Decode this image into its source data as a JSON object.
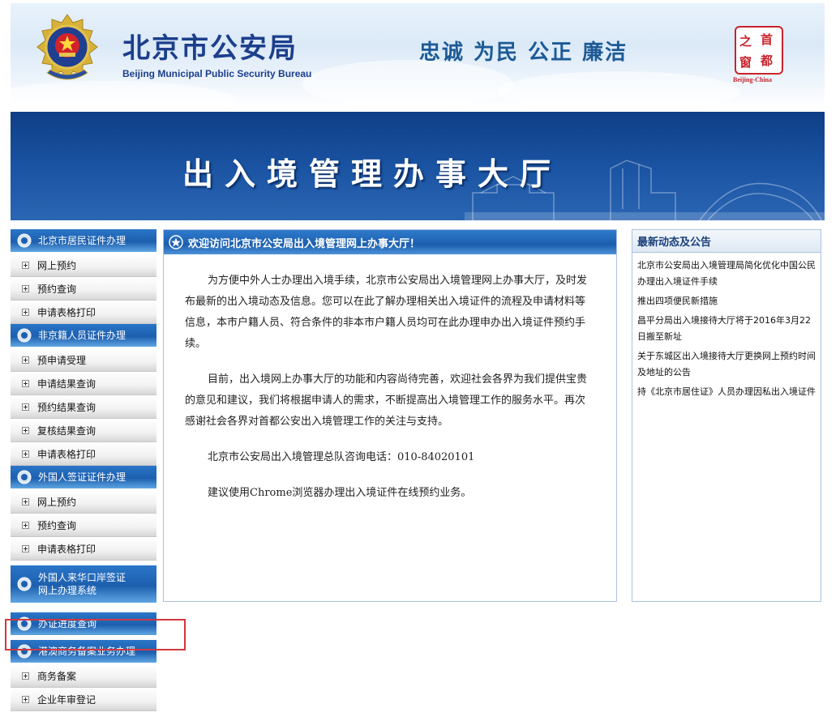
{
  "header": {
    "title_cn": "北京市公安局",
    "title_en": "Beijing Municipal Public Security Bureau",
    "motto": "忠诚  为民  公正  廉洁",
    "seal_chars": [
      "之",
      "首",
      "窗",
      "都"
    ],
    "seal_caption": "Beijing-China"
  },
  "banner": {
    "text": "出入境管理办事大厅"
  },
  "nav": {
    "sections": [
      {
        "title": "北京市居民证件办理",
        "items": [
          "网上预约",
          "预约查询",
          "申请表格打印"
        ]
      },
      {
        "title": "非京籍人员证件办理",
        "items": [
          "预申请受理",
          "申请结果查询",
          "预约结果查询",
          "复核结果查询",
          "申请表格打印"
        ]
      },
      {
        "title": "外国人签证证件办理",
        "items": [
          "网上预约",
          "预约查询",
          "申请表格打印"
        ]
      },
      {
        "title": "外国人来华口岸签证\n网上办理系统",
        "items": []
      },
      {
        "title": "办证进度查询",
        "items": []
      },
      {
        "title": "港澳商务备案业务办理",
        "items": [
          "商务备案",
          "企业年审登记"
        ]
      }
    ]
  },
  "main": {
    "title": "欢迎访问北京市公安局出入境管理网上办事大厅！",
    "paragraphs": [
      "为方便中外人士办理出入境手续，北京市公安局出入境管理网上办事大厅，及时发布最新的出入境动态及信息。您可以在此了解办理相关出入境证件的流程及申请材料等信息，本市户籍人员、符合条件的非本市户籍人员均可在此办理申办出入境证件预约手续。",
      "目前，出入境网上办事大厅的功能和内容尚待完善，欢迎社会各界为我们提供宝贵的意见和建议，我们将根据申请人的需求，不断提高出入境管理工作的服务水平。再次感谢社会各界对首都公安出入境管理工作的关注与支持。",
      "北京市公安局出入境管理总队咨询电话：010-84020101",
      "建议使用Chrome浏览器办理出入境证件在线预约业务。"
    ]
  },
  "news": {
    "title": "最新动态及公告",
    "items": [
      "北京市公安局出入境管理局简化优化中国公民办理出入境证件手续",
      "推出四项便民新措施",
      "昌平分局出入境接待大厅将于2016年3月22日搬至新址",
      "关于东城区出入境接待大厅更换网上预约时间及地址的公告",
      "持《北京市居住证》人员办理因私出入境证件"
    ]
  },
  "colors": {
    "nav_head": "#1d5fae",
    "title_blue": "#1c3f8c",
    "seal_red": "#c8232c",
    "highlight_red": "#d0393e"
  }
}
